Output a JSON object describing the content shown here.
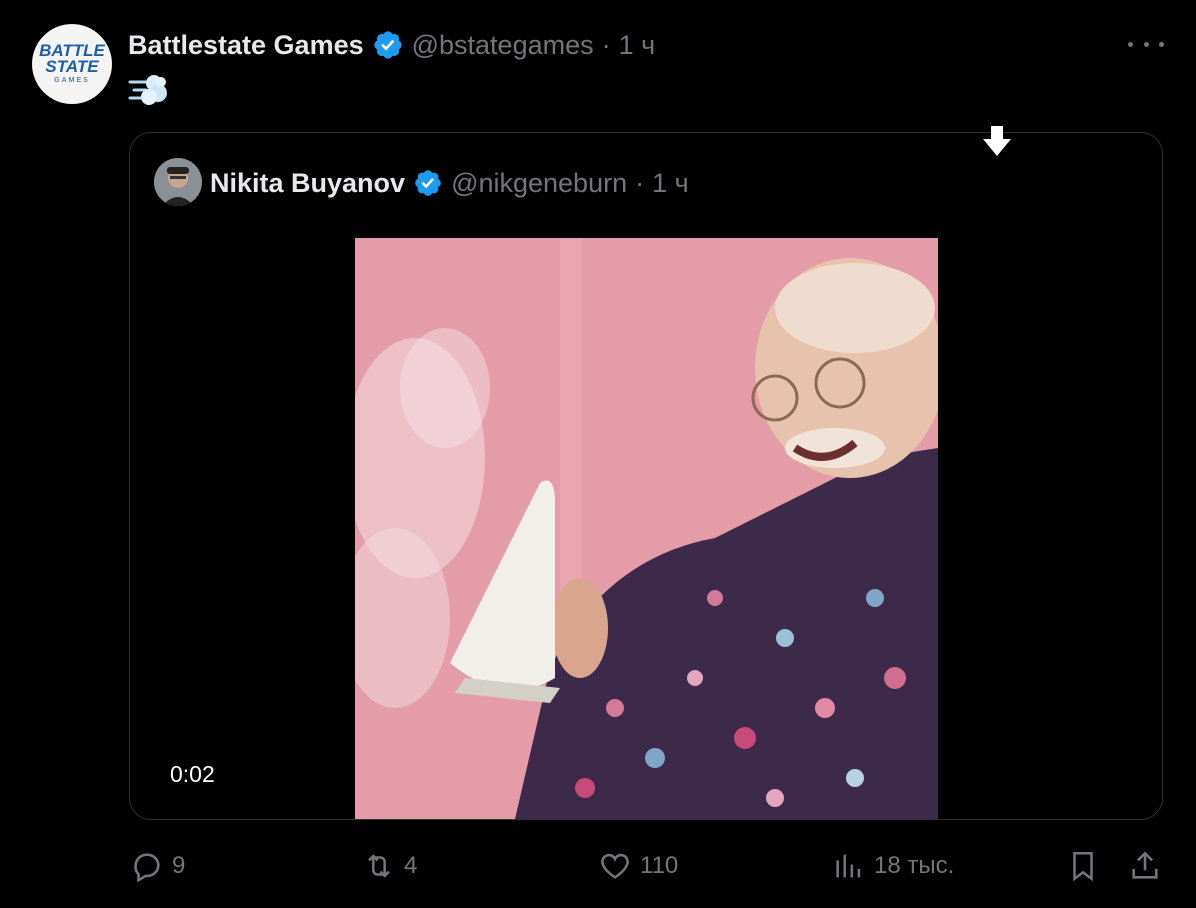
{
  "tweet": {
    "author_name": "Battlestate Games",
    "author_handle": "@bstategames",
    "separator": "·",
    "time": "1 ч",
    "avatar_logo": {
      "line1": "BATTLE",
      "line2": "STATE",
      "line3": "GAMES"
    },
    "emoji": "dashing-away-emoji"
  },
  "quoted_tweet": {
    "author_name": "Nikita Buyanov",
    "author_handle": "@nikgeneburn",
    "separator": "·",
    "time": "1 ч",
    "video": {
      "elapsed": "0:02"
    }
  },
  "actions": {
    "replies": "9",
    "reposts": "4",
    "likes": "110",
    "views": "18 тыс."
  },
  "colors": {
    "background": "#000000",
    "primary_text": "#e7e9ea",
    "secondary_text": "#71767b",
    "verified_badge": "#1d9bf0",
    "border": "#2f3336",
    "video_background": "#e49ca8"
  },
  "icons": [
    "more-icon",
    "verified-icon",
    "reply-icon",
    "repost-icon",
    "like-icon",
    "views-icon",
    "bookmark-icon",
    "share-icon",
    "download-icon"
  ]
}
